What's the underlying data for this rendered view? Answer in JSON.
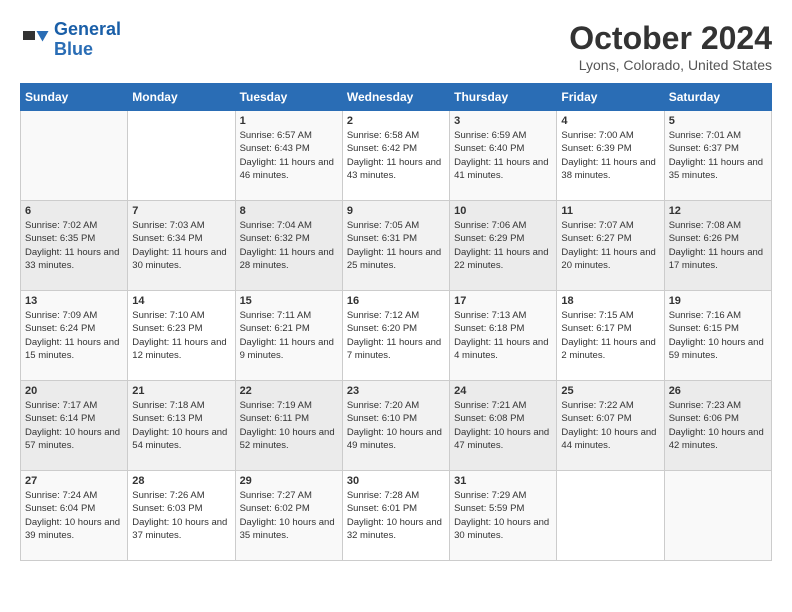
{
  "header": {
    "logo_line1": "General",
    "logo_line2": "Blue",
    "month_title": "October 2024",
    "location": "Lyons, Colorado, United States"
  },
  "days_of_week": [
    "Sunday",
    "Monday",
    "Tuesday",
    "Wednesday",
    "Thursday",
    "Friday",
    "Saturday"
  ],
  "weeks": [
    [
      {
        "day": "",
        "info": ""
      },
      {
        "day": "",
        "info": ""
      },
      {
        "day": "1",
        "info": "Sunrise: 6:57 AM\nSunset: 6:43 PM\nDaylight: 11 hours and 46 minutes."
      },
      {
        "day": "2",
        "info": "Sunrise: 6:58 AM\nSunset: 6:42 PM\nDaylight: 11 hours and 43 minutes."
      },
      {
        "day": "3",
        "info": "Sunrise: 6:59 AM\nSunset: 6:40 PM\nDaylight: 11 hours and 41 minutes."
      },
      {
        "day": "4",
        "info": "Sunrise: 7:00 AM\nSunset: 6:39 PM\nDaylight: 11 hours and 38 minutes."
      },
      {
        "day": "5",
        "info": "Sunrise: 7:01 AM\nSunset: 6:37 PM\nDaylight: 11 hours and 35 minutes."
      }
    ],
    [
      {
        "day": "6",
        "info": "Sunrise: 7:02 AM\nSunset: 6:35 PM\nDaylight: 11 hours and 33 minutes."
      },
      {
        "day": "7",
        "info": "Sunrise: 7:03 AM\nSunset: 6:34 PM\nDaylight: 11 hours and 30 minutes."
      },
      {
        "day": "8",
        "info": "Sunrise: 7:04 AM\nSunset: 6:32 PM\nDaylight: 11 hours and 28 minutes."
      },
      {
        "day": "9",
        "info": "Sunrise: 7:05 AM\nSunset: 6:31 PM\nDaylight: 11 hours and 25 minutes."
      },
      {
        "day": "10",
        "info": "Sunrise: 7:06 AM\nSunset: 6:29 PM\nDaylight: 11 hours and 22 minutes."
      },
      {
        "day": "11",
        "info": "Sunrise: 7:07 AM\nSunset: 6:27 PM\nDaylight: 11 hours and 20 minutes."
      },
      {
        "day": "12",
        "info": "Sunrise: 7:08 AM\nSunset: 6:26 PM\nDaylight: 11 hours and 17 minutes."
      }
    ],
    [
      {
        "day": "13",
        "info": "Sunrise: 7:09 AM\nSunset: 6:24 PM\nDaylight: 11 hours and 15 minutes."
      },
      {
        "day": "14",
        "info": "Sunrise: 7:10 AM\nSunset: 6:23 PM\nDaylight: 11 hours and 12 minutes."
      },
      {
        "day": "15",
        "info": "Sunrise: 7:11 AM\nSunset: 6:21 PM\nDaylight: 11 hours and 9 minutes."
      },
      {
        "day": "16",
        "info": "Sunrise: 7:12 AM\nSunset: 6:20 PM\nDaylight: 11 hours and 7 minutes."
      },
      {
        "day": "17",
        "info": "Sunrise: 7:13 AM\nSunset: 6:18 PM\nDaylight: 11 hours and 4 minutes."
      },
      {
        "day": "18",
        "info": "Sunrise: 7:15 AM\nSunset: 6:17 PM\nDaylight: 11 hours and 2 minutes."
      },
      {
        "day": "19",
        "info": "Sunrise: 7:16 AM\nSunset: 6:15 PM\nDaylight: 10 hours and 59 minutes."
      }
    ],
    [
      {
        "day": "20",
        "info": "Sunrise: 7:17 AM\nSunset: 6:14 PM\nDaylight: 10 hours and 57 minutes."
      },
      {
        "day": "21",
        "info": "Sunrise: 7:18 AM\nSunset: 6:13 PM\nDaylight: 10 hours and 54 minutes."
      },
      {
        "day": "22",
        "info": "Sunrise: 7:19 AM\nSunset: 6:11 PM\nDaylight: 10 hours and 52 minutes."
      },
      {
        "day": "23",
        "info": "Sunrise: 7:20 AM\nSunset: 6:10 PM\nDaylight: 10 hours and 49 minutes."
      },
      {
        "day": "24",
        "info": "Sunrise: 7:21 AM\nSunset: 6:08 PM\nDaylight: 10 hours and 47 minutes."
      },
      {
        "day": "25",
        "info": "Sunrise: 7:22 AM\nSunset: 6:07 PM\nDaylight: 10 hours and 44 minutes."
      },
      {
        "day": "26",
        "info": "Sunrise: 7:23 AM\nSunset: 6:06 PM\nDaylight: 10 hours and 42 minutes."
      }
    ],
    [
      {
        "day": "27",
        "info": "Sunrise: 7:24 AM\nSunset: 6:04 PM\nDaylight: 10 hours and 39 minutes."
      },
      {
        "day": "28",
        "info": "Sunrise: 7:26 AM\nSunset: 6:03 PM\nDaylight: 10 hours and 37 minutes."
      },
      {
        "day": "29",
        "info": "Sunrise: 7:27 AM\nSunset: 6:02 PM\nDaylight: 10 hours and 35 minutes."
      },
      {
        "day": "30",
        "info": "Sunrise: 7:28 AM\nSunset: 6:01 PM\nDaylight: 10 hours and 32 minutes."
      },
      {
        "day": "31",
        "info": "Sunrise: 7:29 AM\nSunset: 5:59 PM\nDaylight: 10 hours and 30 minutes."
      },
      {
        "day": "",
        "info": ""
      },
      {
        "day": "",
        "info": ""
      }
    ]
  ]
}
